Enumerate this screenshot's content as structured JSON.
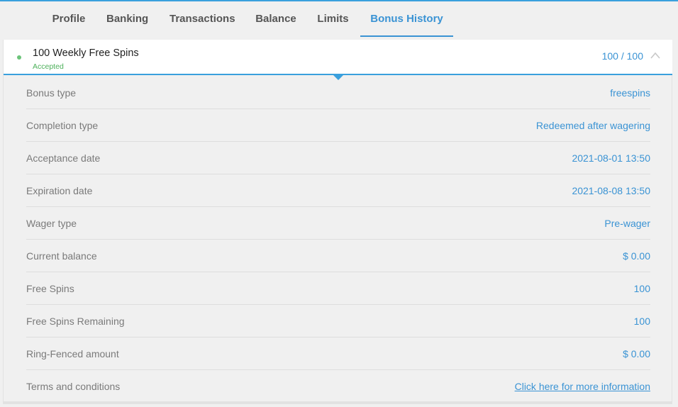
{
  "tabs": [
    {
      "label": "Profile",
      "active": false
    },
    {
      "label": "Banking",
      "active": false
    },
    {
      "label": "Transactions",
      "active": false
    },
    {
      "label": "Balance",
      "active": false
    },
    {
      "label": "Limits",
      "active": false
    },
    {
      "label": "Bonus History",
      "active": true
    }
  ],
  "bonus": {
    "title": "100 Weekly Free Spins",
    "status": "Accepted",
    "progress": "100 / 100",
    "expanded": true,
    "icons": {
      "status": "status-dot-icon",
      "toggle": "chevron-up-icon"
    }
  },
  "details": [
    {
      "label": "Bonus type",
      "value": "freespins"
    },
    {
      "label": "Completion type",
      "value": "Redeemed after wagering"
    },
    {
      "label": "Acceptance date",
      "value": "2021-08-01 13:50"
    },
    {
      "label": "Expiration date",
      "value": "2021-08-08 13:50"
    },
    {
      "label": "Wager type",
      "value": "Pre-wager"
    },
    {
      "label": "Current balance",
      "value": "$ 0.00"
    },
    {
      "label": "Free Spins",
      "value": "100"
    },
    {
      "label": "Free Spins Remaining",
      "value": "100"
    },
    {
      "label": "Ring-Fenced amount",
      "value": "$ 0.00"
    },
    {
      "label": "Terms and conditions",
      "value": "Click here for more information",
      "link": true
    }
  ],
  "colors": {
    "accent": "#3a93d4",
    "accepted": "#4cb05a",
    "label": "#7a7a7a",
    "panel": "#f0f0f0"
  }
}
